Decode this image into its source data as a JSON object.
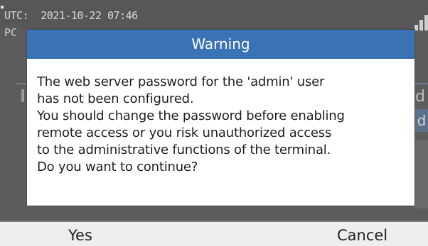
{
  "status_bar": {
    "utc_label": "UTC:",
    "utc_datetime": "2021-10-22 07:46",
    "partial_label": "PC",
    "signal_icon": "signal-bars-icon"
  },
  "background": {
    "fragment_d": "d",
    "fragment_highlight": "d"
  },
  "dialog": {
    "title": "Warning",
    "message_lines": [
      "The web server password for the 'admin' user",
      "has not been configured.",
      "You should change the password before enabling",
      "remote access or you risk unauthorized access",
      "to the administrative functions of the terminal.",
      "Do you want to continue?"
    ]
  },
  "softkeys": {
    "yes_label": "Yes",
    "cancel_label": "Cancel"
  },
  "colors": {
    "title_bar": "#3a73b5",
    "overlay": "#5c5c5c",
    "softkey_bar": "#eeeeee"
  }
}
